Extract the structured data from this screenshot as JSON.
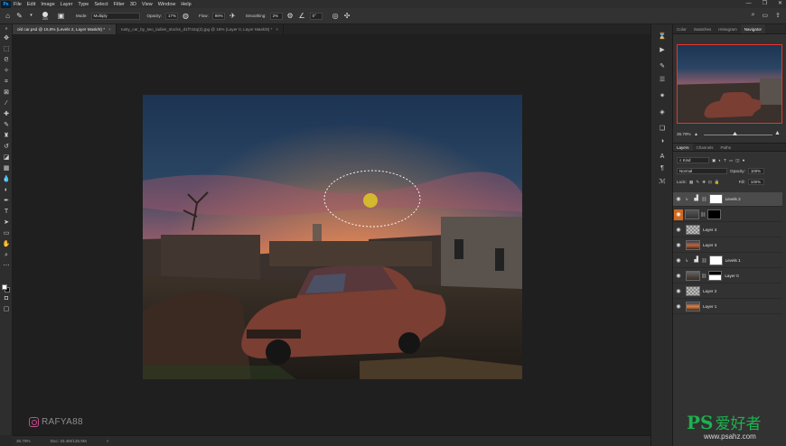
{
  "menubar": {
    "logo": "Ps",
    "items": [
      "File",
      "Edit",
      "Image",
      "Layer",
      "Type",
      "Select",
      "Filter",
      "3D",
      "View",
      "Window",
      "Help"
    ],
    "window_controls": [
      "—",
      "❐",
      "✕"
    ]
  },
  "options": {
    "brush_size": "200",
    "mode_label": "Mode:",
    "mode_value": "Multiply",
    "opacity_label": "Opacity:",
    "opacity_value": "17%",
    "flow_label": "Flow:",
    "flow_value": "99%",
    "smoothing_label": "Smoothing:",
    "smoothing_value": "2%",
    "angle_value": "0°"
  },
  "tabs": [
    {
      "title": "old car.psd @ 16,8% (Levels 2, Layer Mask/8) *",
      "active": true
    },
    {
      "title": "rusty_car_by_two_ladies_stocks_d1f742q(2).jpg @ 16% (Layer 0, Layer Mask/8) *",
      "active": false
    }
  ],
  "status": {
    "zoom": "36.79%",
    "doc": "Doc: 33.4M/135.9M",
    "arrow": ">"
  },
  "watermark": {
    "handle": "RAFYA88"
  },
  "navigator": {
    "tabs": [
      "Color",
      "Swatches",
      "Histogram",
      "Navigator"
    ],
    "active_tab": "Navigator",
    "zoom": "36.79%",
    "frame_color": "#e8352c"
  },
  "layers_panel": {
    "tabs": [
      "Layers",
      "Channels",
      "Paths"
    ],
    "active_tab": "Layers",
    "filter_label": "Kind",
    "blend_mode": "Normal",
    "opacity_label": "Opacity:",
    "opacity_value": "100%",
    "lock_label": "Lock:",
    "fill_label": "Fill:",
    "fill_value": "100%",
    "layers": [
      {
        "name": "Levels 2",
        "type": "adjustment",
        "selected": true
      },
      {
        "name": "",
        "type": "masked",
        "selected": false
      },
      {
        "name": "Layer 4",
        "type": "image",
        "selected": false
      },
      {
        "name": "Layer 3",
        "type": "image",
        "selected": false
      },
      {
        "name": "Levels 1",
        "type": "adjustment",
        "selected": false
      },
      {
        "name": "Layer 0",
        "type": "masked",
        "selected": false
      },
      {
        "name": "Layer 2",
        "type": "image",
        "selected": false
      },
      {
        "name": "Layer 1",
        "type": "image",
        "selected": false
      }
    ]
  },
  "brand": {
    "ps": "PS",
    "cn": "爱好者",
    "url": "www.psahz.com"
  },
  "colors": {
    "accent_orange": "#d2691e",
    "brand_green": "#1db14f"
  }
}
